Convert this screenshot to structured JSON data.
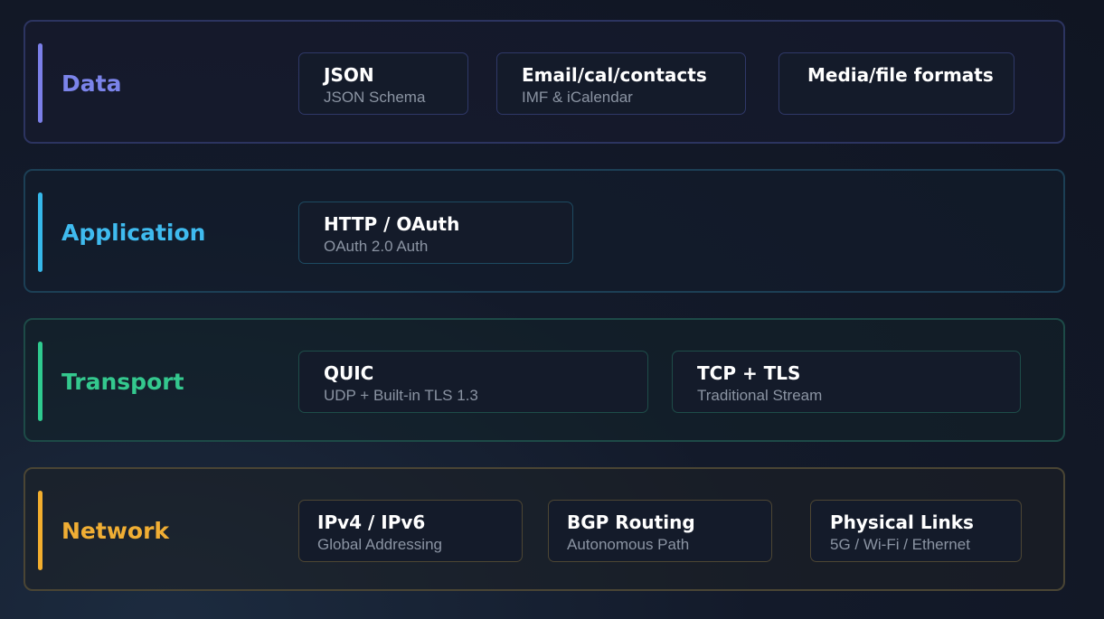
{
  "layers": [
    {
      "name": "Data",
      "color": "#7b84ea",
      "cards": [
        {
          "title": "JSON",
          "subtitle": "JSON Schema"
        },
        {
          "title": "Email/cal/contacts",
          "subtitle": "IMF & iCalendar"
        },
        {
          "title": "Media/file formats",
          "subtitle": ""
        }
      ]
    },
    {
      "name": "Application",
      "color": "#3fbbef",
      "cards": [
        {
          "title": "HTTP / OAuth",
          "subtitle": "OAuth 2.0 Auth"
        }
      ]
    },
    {
      "name": "Transport",
      "color": "#34c88e",
      "cards": [
        {
          "title": "QUIC",
          "subtitle": "UDP + Built-in TLS 1.3"
        },
        {
          "title": "TCP + TLS",
          "subtitle": "Traditional Stream"
        }
      ]
    },
    {
      "name": "Network",
      "color": "#f0ae34",
      "cards": [
        {
          "title": "IPv4 / IPv6",
          "subtitle": "Global Addressing"
        },
        {
          "title": "BGP Routing",
          "subtitle": "Autonomous Path"
        },
        {
          "title": "Physical Links",
          "subtitle": "5G / Wi-Fi / Ethernet"
        }
      ]
    }
  ]
}
